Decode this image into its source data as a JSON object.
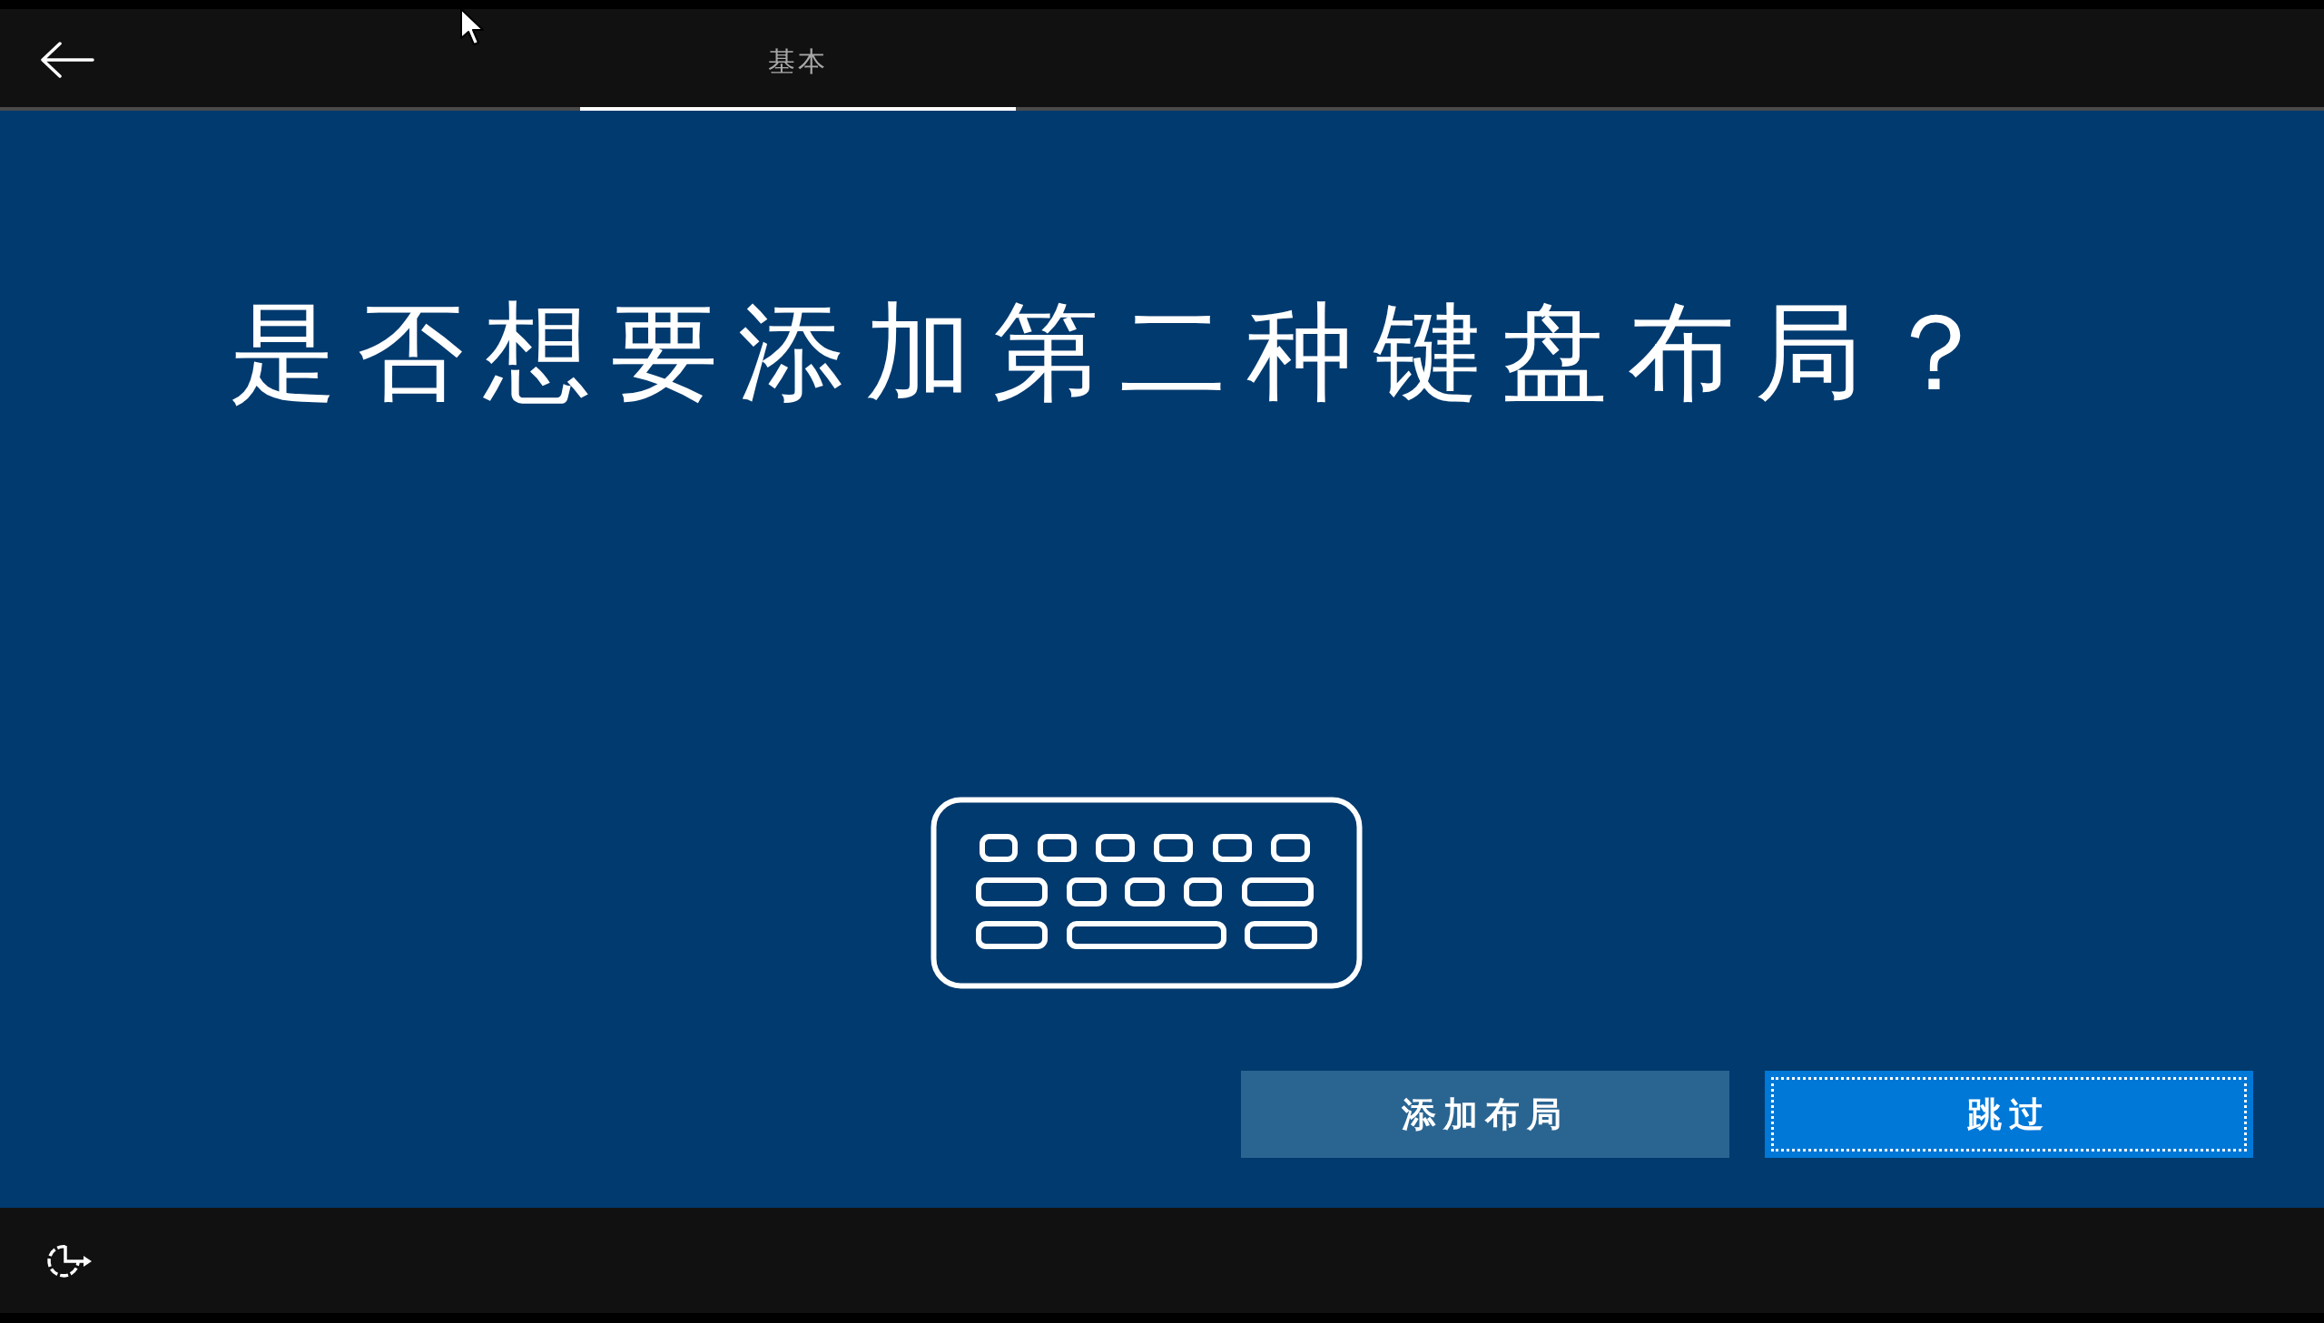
{
  "top_bar": {
    "tabs": [
      {
        "label": "基本",
        "selected": true
      }
    ]
  },
  "heading": "是否想要添加第二种键盘布局？",
  "buttons": [
    {
      "label": "添加布局",
      "kind": "secondary",
      "focused": false
    },
    {
      "label": "跳过",
      "kind": "primary",
      "focused": true
    }
  ]
}
